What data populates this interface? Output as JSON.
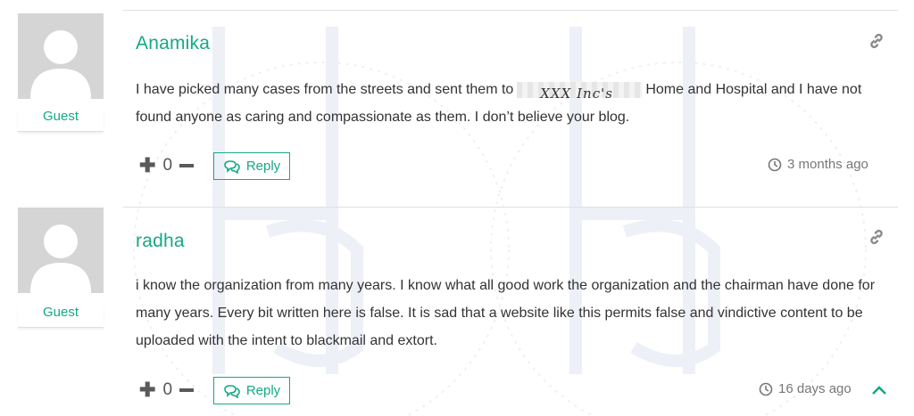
{
  "comments": [
    {
      "author": "Anamika",
      "role": "Guest",
      "text_before": "I have picked many cases from the streets and sent them to",
      "redacted": "XXX Inc's",
      "text_after": "Home and Hospital and I have not found anyone as caring and compassionate as them. I don’t believe your blog.",
      "votes": "0",
      "reply_label": "Reply",
      "time": "3 months ago"
    },
    {
      "author": "radha",
      "role": "Guest",
      "text": "i know the organization from many years. I know what all good work the organization and the chairman have done for many years. Every bit written here is false. It is sad that a website like this permits false and vindictive content to be uploaded with the intent to blackmail and extort.",
      "votes": "0",
      "reply_label": "Reply",
      "time": "16 days ago"
    }
  ],
  "colors": {
    "accent": "#16a887",
    "text": "#333333",
    "muted": "#777777"
  },
  "icons": [
    "user-avatar-icon",
    "link-icon",
    "plus-icon",
    "minus-icon",
    "reply-icon",
    "clock-icon",
    "chevron-up-icon"
  ]
}
